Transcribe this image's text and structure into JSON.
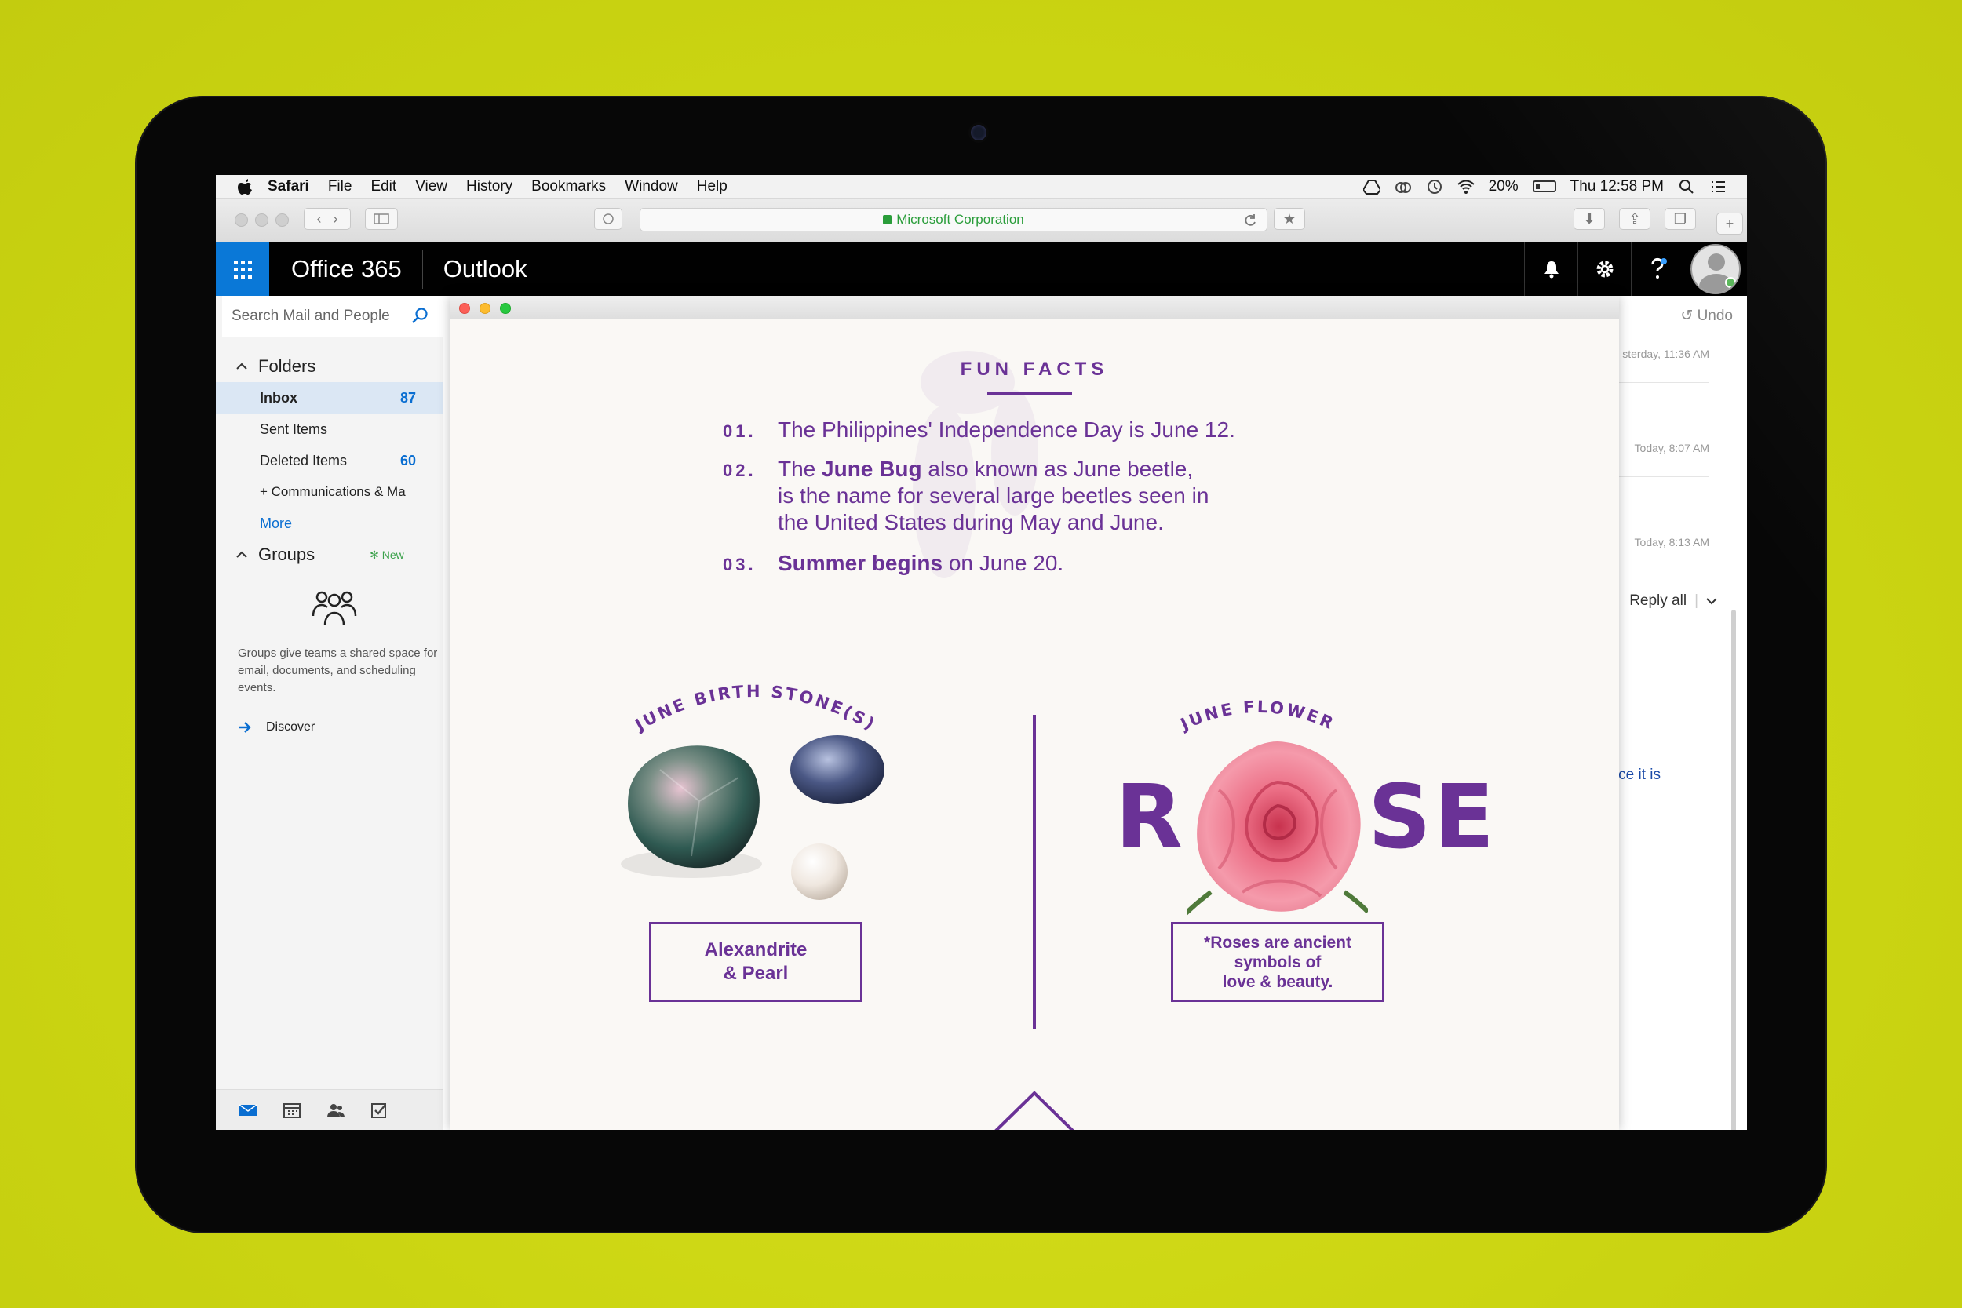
{
  "colors": {
    "background": "#cbd512",
    "accent_purple": "#6a3296",
    "o365_blue": "#0a78d7",
    "link_blue": "#0a6ed1",
    "secure_green": "#2a9d3a"
  },
  "menubar": {
    "items": [
      "Safari",
      "File",
      "Edit",
      "View",
      "History",
      "Bookmarks",
      "Window",
      "Help"
    ],
    "battery": "20%",
    "clock": "Thu 12:58 PM"
  },
  "browser": {
    "address": "Microsoft Corporation"
  },
  "o365": {
    "brand": "Office 365",
    "app": "Outlook"
  },
  "nav": {
    "search_placeholder": "Search Mail and People",
    "folders_header": "Folders",
    "folders": [
      {
        "label": "Inbox",
        "count": "87"
      },
      {
        "label": "Sent Items",
        "count": ""
      },
      {
        "label": "Deleted Items",
        "count": "60"
      },
      {
        "label": "+ Communications & Ma",
        "count": ""
      }
    ],
    "more": "More",
    "groups_header": "Groups",
    "groups_new": "New",
    "groups_text": "Groups give teams a shared space for email, documents, and scheduling events.",
    "discover": "Discover"
  },
  "reading": {
    "undo": "Undo",
    "stamps": [
      "sterday, 11:36 AM",
      "Today, 8:07 AM",
      "Today, 8:13 AM"
    ],
    "reply_all": "Reply all",
    "link_fragment": "ce it is"
  },
  "newsletter": {
    "fun_facts_title": "FUN FACTS",
    "facts": [
      {
        "num": "01.",
        "html_parts": [
          "The Philippines' Independence Day is June 12."
        ]
      },
      {
        "num": "02.",
        "bold": "June Bug",
        "line1_pre": "The ",
        "line1_post": " also known as June beetle,",
        "line2": "is the name for several large beetles seen in",
        "line3": "the United States during May and June."
      },
      {
        "num": "03.",
        "bold": "Summer begins",
        "post": " on June 20."
      }
    ],
    "birthstone_label": "JUNE BIRTH STONE(S)",
    "birthstone_box": [
      "Alexandrite",
      "& Pearl"
    ],
    "flower_label": "JUNE FLOWER",
    "flower_word_left": "R",
    "flower_word_right": "SE",
    "flower_box": [
      "*Roses are ancient",
      "symbols of",
      "love & beauty."
    ]
  }
}
